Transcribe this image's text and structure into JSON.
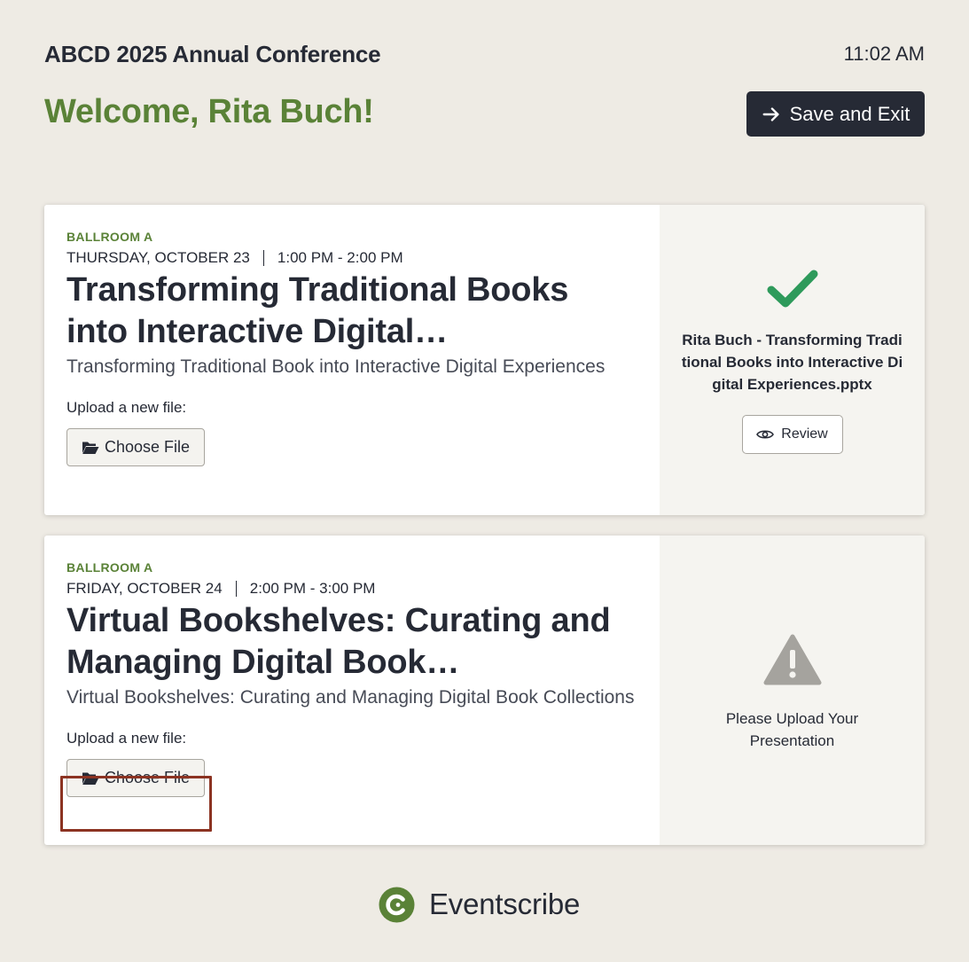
{
  "header": {
    "conference_title": "ABCD 2025 Annual Conference",
    "time": "11:02 AM",
    "welcome": "Welcome, Rita Buch!",
    "save_exit_label": "Save and Exit"
  },
  "sessions": [
    {
      "room": "BALLROOM A",
      "date": "THURSDAY, OCTOBER 23",
      "time": "1:00 PM - 2:00 PM",
      "title": "Transforming Traditional Books into Interactive Digital…",
      "subtitle": "Transforming Traditional Book into Interactive Digital Experiences",
      "upload_label": "Upload a new file:",
      "choose_file_label": "Choose File",
      "status": "uploaded",
      "status_icon": "check-icon",
      "file_name": "Rita Buch - Transforming Traditional Books into Interactive Digital Experiences.pptx",
      "review_label": "Review"
    },
    {
      "room": "BALLROOM A",
      "date": "FRIDAY, OCTOBER 24",
      "time": "2:00 PM - 3:00 PM",
      "title": "Virtual Bookshelves: Curating and Managing Digital Book…",
      "subtitle": "Virtual Bookshelves: Curating and Managing Digital Book Collections",
      "upload_label": "Upload a new file:",
      "choose_file_label": "Choose File",
      "status": "missing",
      "status_icon": "warning-icon",
      "status_message": "Please Upload Your Presentation"
    }
  ],
  "footer": {
    "brand": "Eventscribe"
  },
  "colors": {
    "background": "#eeebe4",
    "accent_green": "#5a8237",
    "dark": "#262a35",
    "check_green": "#2e9a5b",
    "warning_gray": "#a5a39e",
    "focus_ring": "#8c3322"
  }
}
